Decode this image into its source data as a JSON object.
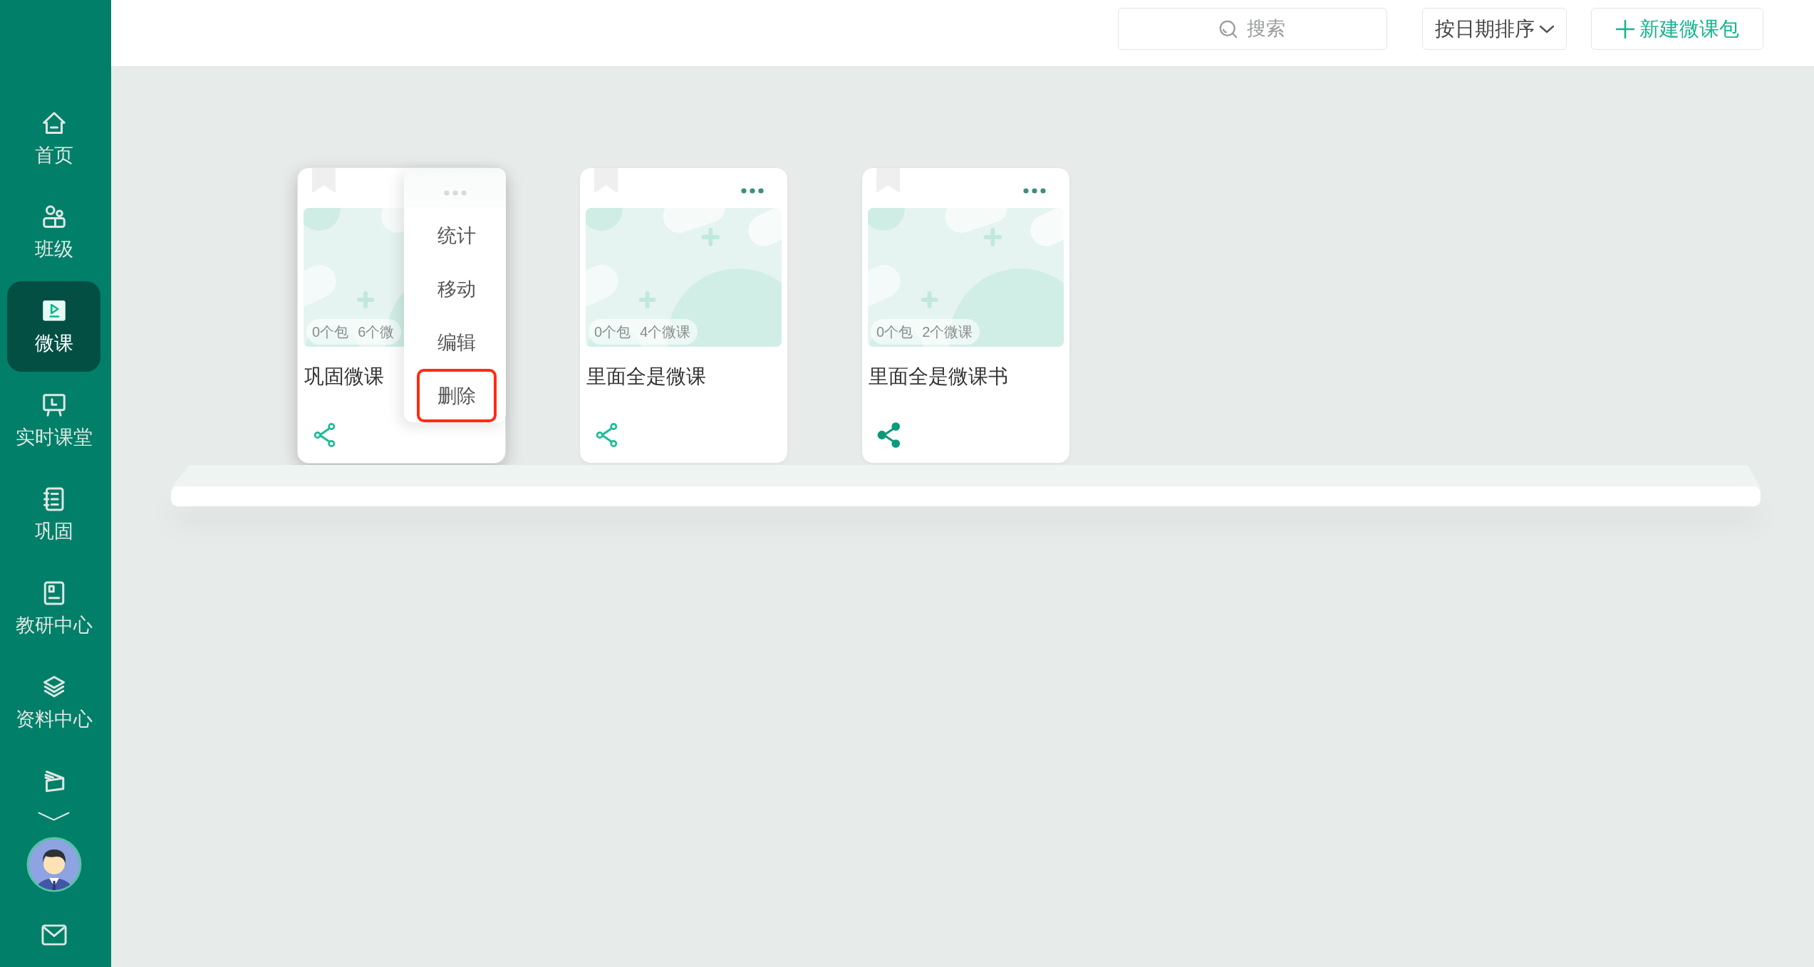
{
  "sidebar": {
    "items": [
      {
        "label": "首页",
        "selected": false
      },
      {
        "label": "班级",
        "selected": false
      },
      {
        "label": "微课",
        "selected": true
      },
      {
        "label": "实时课堂",
        "selected": false
      },
      {
        "label": "巩固",
        "selected": false
      },
      {
        "label": "教研中心",
        "selected": false
      },
      {
        "label": "资料中心",
        "selected": false
      }
    ]
  },
  "toolbar": {
    "search": {
      "placeholder": "搜索"
    },
    "sort": {
      "label": "按日期排序"
    },
    "new_button": {
      "label": "新建微课包"
    }
  },
  "cards": [
    {
      "title": "巩固微课",
      "packages": "0个包",
      "lessons": "6个微",
      "shared": false,
      "menu": {
        "items": [
          {
            "label": "统计",
            "selected": false
          },
          {
            "label": "移动",
            "selected": false
          },
          {
            "label": "编辑",
            "selected": false
          },
          {
            "label": "删除",
            "selected": true
          }
        ]
      }
    },
    {
      "title": "里面全是微课",
      "packages": "0个包",
      "lessons": "4个微课",
      "shared": false
    },
    {
      "title": "里面全是微课书",
      "packages": "0个包",
      "lessons": "2个微课",
      "shared": true
    }
  ]
}
